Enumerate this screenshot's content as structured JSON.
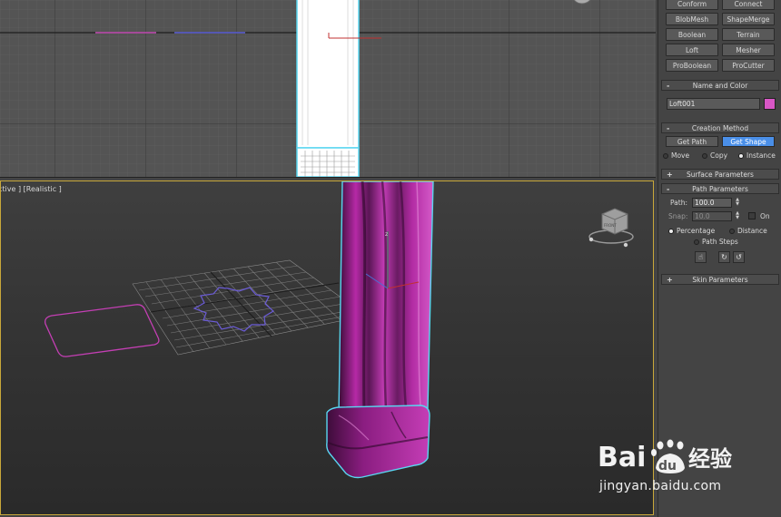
{
  "viewport_top": {},
  "viewport_perspective": {
    "label": "ctive ] [Realistic ]",
    "axis_z_label": "z",
    "viewcube_label": "FRONT"
  },
  "panel": {
    "object_buttons": [
      {
        "label": "Conform"
      },
      {
        "label": "Connect"
      },
      {
        "label": "BlobMesh"
      },
      {
        "label": "ShapeMerge"
      },
      {
        "label": "Boolean"
      },
      {
        "label": "Terrain"
      },
      {
        "label": "Loft"
      },
      {
        "label": "Mesher"
      },
      {
        "label": "ProBoolean"
      },
      {
        "label": "ProCutter"
      }
    ],
    "name_and_color": {
      "title": "Name and Color",
      "name_value": "Loft001",
      "color": "#d857c6"
    },
    "creation_method": {
      "title": "Creation Method",
      "get_path": "Get Path",
      "get_shape": "Get Shape",
      "move": "Move",
      "copy": "Copy",
      "instance": "Instance",
      "selected": "instance"
    },
    "surface_parameters": {
      "title": "Surface Parameters"
    },
    "path_parameters": {
      "title": "Path Parameters",
      "path_label": "Path:",
      "path_value": "100.0",
      "snap_label": "Snap:",
      "snap_value": "10.0",
      "on_label": "On",
      "percentage": "Percentage",
      "distance": "Distance",
      "path_steps": "Path Steps"
    },
    "skin_parameters": {
      "title": "Skin Parameters"
    },
    "collapse_sign": "-",
    "expand_sign": "+"
  },
  "watermark": {
    "brand_a": "Bai",
    "brand_b": "du",
    "brand_cn": "经验",
    "url": "jingyan.baidu.com"
  },
  "colors": {
    "accent_blue": "#4a8fe8",
    "active_viewport_border": "#c9a83a",
    "object_magenta": "#b0279f",
    "selection_cyan": "#58d6f0"
  }
}
